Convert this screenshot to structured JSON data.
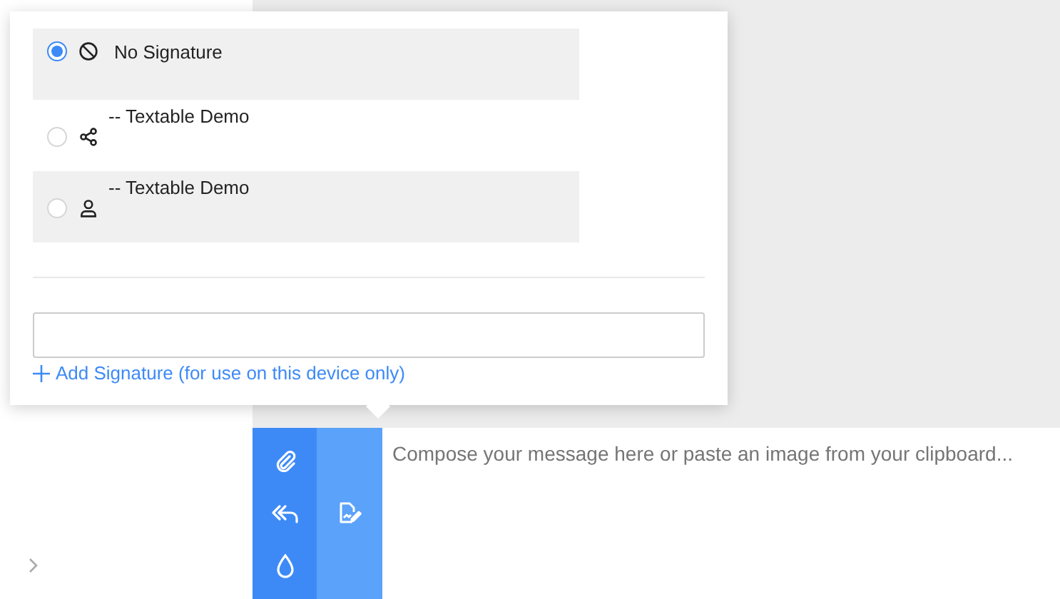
{
  "signature_menu": {
    "options": [
      {
        "kind": "none",
        "label": "No Signature",
        "selected": true
      },
      {
        "kind": "shared",
        "label": "-- Textable Demo",
        "selected": false
      },
      {
        "kind": "personal",
        "label": "-- Textable Demo",
        "selected": false
      }
    ],
    "add_link": "Add Signature (for use on this device only)"
  },
  "composer": {
    "placeholder": "Compose your message here or paste an image from your clipboard..."
  }
}
